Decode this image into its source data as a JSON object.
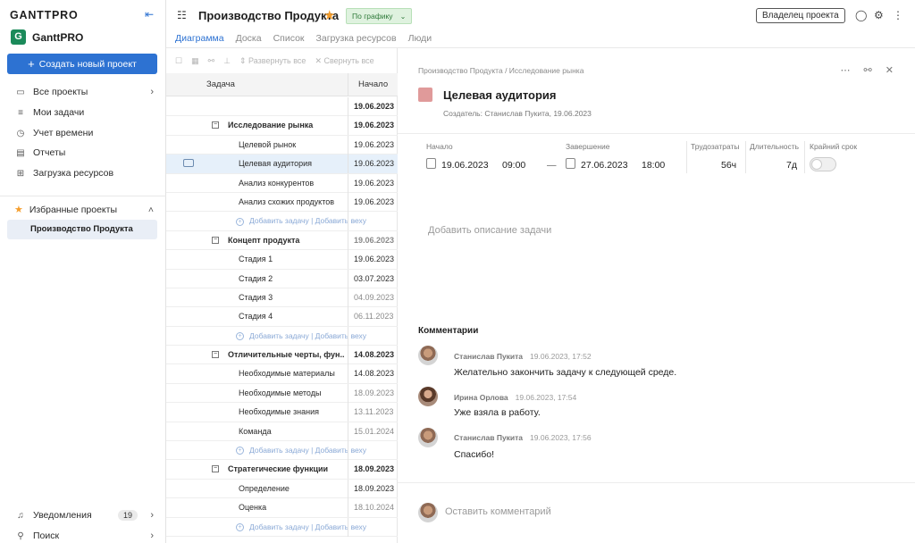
{
  "sidebar": {
    "brand": "GANTTPRO",
    "workspace_logo": "G",
    "workspace": "GanttPRO",
    "create_label": "Создать новый проект",
    "nav": [
      {
        "label": "Все проекты",
        "icon": "folder-icon"
      },
      {
        "label": "Мои задачи",
        "icon": "list-icon"
      },
      {
        "label": "Учет времени",
        "icon": "clock-icon"
      },
      {
        "label": "Отчеты",
        "icon": "report-icon"
      },
      {
        "label": "Загрузка ресурсов",
        "icon": "grid-icon"
      }
    ],
    "favorites_label": "Избранные проекты",
    "favorite_item": "Производство Продукта",
    "notifications_label": "Уведомления",
    "notifications_count": "19",
    "search_label": "Поиск"
  },
  "header": {
    "title": "Производство Продукта",
    "schedule": "По графику",
    "tabs": [
      "Диаграмма",
      "Доска",
      "Список",
      "Загрузка ресурсов",
      "Люди"
    ],
    "owner": "Владелец проекта"
  },
  "toolbar": {
    "expand": "Развернуть все",
    "collapse": "Свернуть все"
  },
  "grid": {
    "col_task": "Задача",
    "col_start": "Начало",
    "add_task": "Добавить задачу",
    "add_milestone": "Добавить веху",
    "rows": [
      {
        "name": "",
        "date": "19.06.2023",
        "type": "root"
      },
      {
        "name": "Исследование рынка",
        "date": "19.06.2023",
        "type": "group"
      },
      {
        "name": "Целевой рынок",
        "date": "19.06.2023",
        "type": "task"
      },
      {
        "name": "Целевая аудитория",
        "date": "19.06.2023",
        "type": "task",
        "selected": true
      },
      {
        "name": "Анализ конкурентов",
        "date": "19.06.2023",
        "type": "task"
      },
      {
        "name": "Анализ схожих продуктов",
        "date": "19.06.2023",
        "type": "task"
      },
      {
        "type": "add"
      },
      {
        "name": "Концепт продукта",
        "date": "19.06.2023",
        "type": "group",
        "grey": true
      },
      {
        "name": "Стадия 1",
        "date": "19.06.2023",
        "type": "task"
      },
      {
        "name": "Стадия 2",
        "date": "03.07.2023",
        "type": "task"
      },
      {
        "name": "Стадия 3",
        "date": "04.09.2023",
        "type": "task",
        "grey": true
      },
      {
        "name": "Стадия 4",
        "date": "06.11.2023",
        "type": "task",
        "grey": true
      },
      {
        "type": "add"
      },
      {
        "name": "Отличительные черты, фун...",
        "date": "14.08.2023",
        "type": "group"
      },
      {
        "name": "Необходимые материалы",
        "date": "14.08.2023",
        "type": "task"
      },
      {
        "name": "Необходимые методы",
        "date": "18.09.2023",
        "type": "task",
        "grey": true
      },
      {
        "name": "Необходимые знания",
        "date": "13.11.2023",
        "type": "task",
        "grey": true
      },
      {
        "name": "Команда",
        "date": "15.01.2024",
        "type": "task",
        "grey": true
      },
      {
        "type": "add"
      },
      {
        "name": "Стратегические функции",
        "date": "18.09.2023",
        "type": "group"
      },
      {
        "name": "Определение",
        "date": "18.09.2023",
        "type": "task"
      },
      {
        "name": "Оценка",
        "date": "18.10.2024",
        "type": "task",
        "grey": true
      },
      {
        "type": "add"
      }
    ]
  },
  "detail": {
    "breadcrumb": "Производство Продукта / Исследование рынка",
    "title": "Целевая аудитория",
    "creator": "Создатель: Станислав Пукита, 19.06.2023",
    "start_label": "Начало",
    "start_date": "19.06.2023",
    "start_time": "09:00",
    "dash": "—",
    "end_label": "Завершение",
    "end_date": "27.06.2023",
    "end_time": "18:00",
    "effort_label": "Трудозатраты",
    "effort": "56ч",
    "duration_label": "Длительность",
    "duration": "7д",
    "deadline_label": "Крайний срок",
    "description_placeholder": "Добавить описание задачи",
    "comments_title": "Комментарии",
    "comments": [
      {
        "author": "Станислав Пукита",
        "time": "19.06.2023, 17:52",
        "text": "Желательно закончить задачу к следующей среде."
      },
      {
        "author": "Ирина Орлова",
        "time": "19.06.2023, 17:54",
        "text": "Уже взяла в работу."
      },
      {
        "author": "Станислав Пукита",
        "time": "19.06.2023, 17:56",
        "text": "Спасибо!"
      }
    ],
    "leave_comment": "Оставить комментарий"
  }
}
